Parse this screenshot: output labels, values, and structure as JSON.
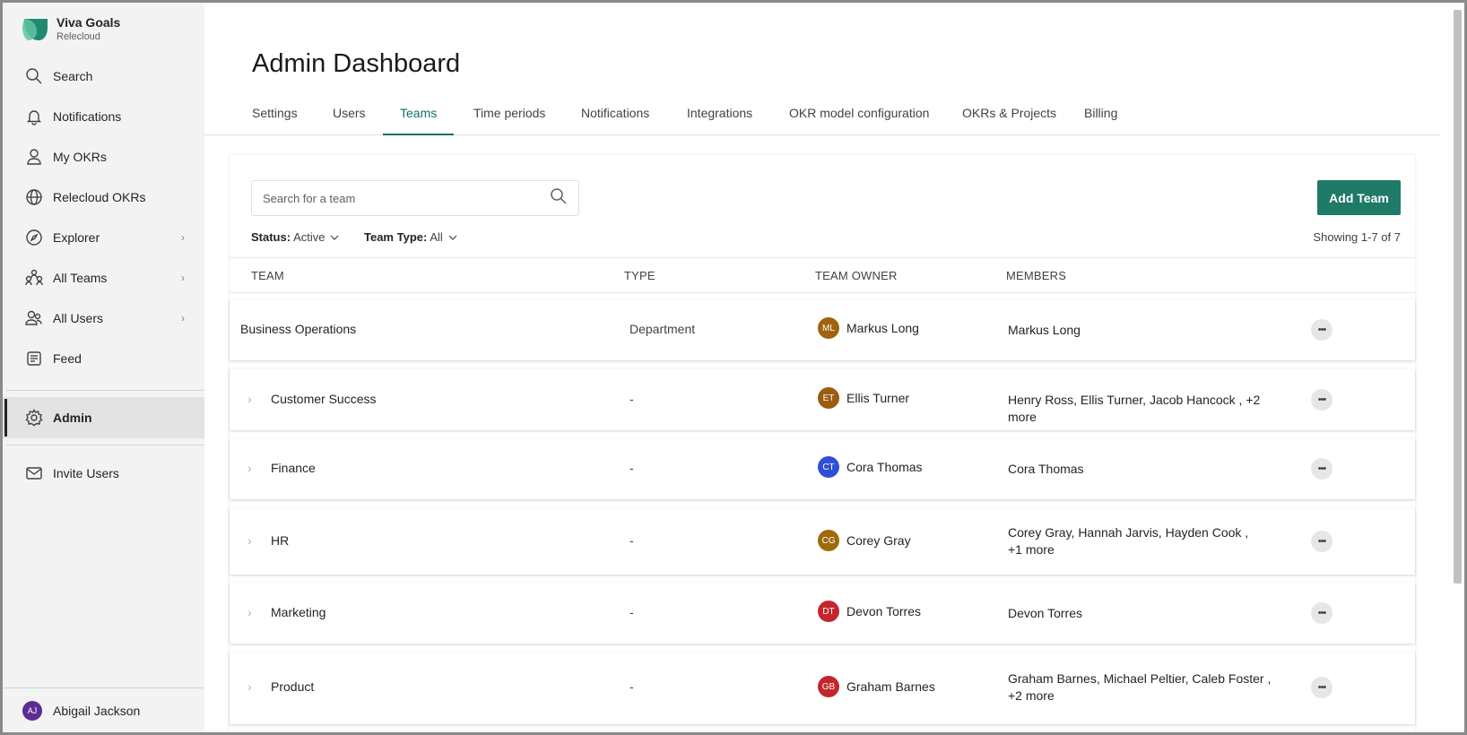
{
  "app": {
    "name": "Viva Goals",
    "org": "Relecloud"
  },
  "sidebar": {
    "items": [
      {
        "label": "Search",
        "icon": "search-icon"
      },
      {
        "label": "Notifications",
        "icon": "bell-icon"
      },
      {
        "label": "My OKRs",
        "icon": "person-icon"
      },
      {
        "label": "Relecloud OKRs",
        "icon": "globe-icon"
      },
      {
        "label": "Explorer",
        "icon": "compass-icon",
        "chevron": "›"
      },
      {
        "label": "All Teams",
        "icon": "teams-icon",
        "chevron": "›"
      },
      {
        "label": "All Users",
        "icon": "users-icon",
        "chevron": "›"
      },
      {
        "label": "Feed",
        "icon": "feed-icon"
      },
      {
        "label": "Admin",
        "icon": "gear-icon"
      },
      {
        "label": "Invite Users",
        "icon": "mail-icon"
      }
    ],
    "user": {
      "initials": "AJ",
      "name": "Abigail Jackson"
    }
  },
  "page": {
    "title": "Admin Dashboard"
  },
  "tabs": [
    "Settings",
    "Users",
    "Teams",
    "Time periods",
    "Notifications",
    "Integrations",
    "OKR model configuration",
    "OKRs & Projects",
    "Billing"
  ],
  "active_tab": "Teams",
  "toolbar": {
    "search_placeholder": "Search for a team",
    "add_label": "Add Team",
    "status_label": "Status:",
    "status_value": "Active",
    "type_label": "Team Type:",
    "type_value": "All",
    "showing": "Showing 1-7 of 7"
  },
  "table": {
    "headers": [
      "TEAM",
      "TYPE",
      "TEAM OWNER",
      "MEMBERS"
    ],
    "rows": [
      {
        "team": "Business Operations",
        "type": "Department",
        "owner": "Markus Long",
        "owner_initials": "ML",
        "owner_color": "#a0620d",
        "members": "Markus Long"
      },
      {
        "team": "Customer Success",
        "type": "-",
        "owner": "Ellis Turner",
        "owner_initials": "ET",
        "owner_color": "#9b5c10",
        "members": "Henry Ross, Ellis Turner, Jacob Hancock , +2 more"
      },
      {
        "team": "Finance",
        "type": "-",
        "owner": "Cora Thomas",
        "owner_initials": "CT",
        "owner_color": "#2e4fd6",
        "members": "Cora Thomas"
      },
      {
        "team": "HR",
        "type": "-",
        "owner": "Corey Gray",
        "owner_initials": "CG",
        "owner_color": "#a06a0a",
        "members": "Corey Gray, Hannah Jarvis, Hayden Cook , +1 more"
      },
      {
        "team": "Marketing",
        "type": "-",
        "owner": "Devon Torres",
        "owner_initials": "DT",
        "owner_color": "#c4262e",
        "members": "Devon Torres"
      },
      {
        "team": "Product",
        "type": "-",
        "owner": "Graham Barnes",
        "owner_initials": "GB",
        "owner_color": "#c4262e",
        "members": "Graham Barnes, Michael Peltier, Caleb Foster , +2 more"
      }
    ],
    "more_glyph": "•••",
    "expand_glyph": "›"
  }
}
